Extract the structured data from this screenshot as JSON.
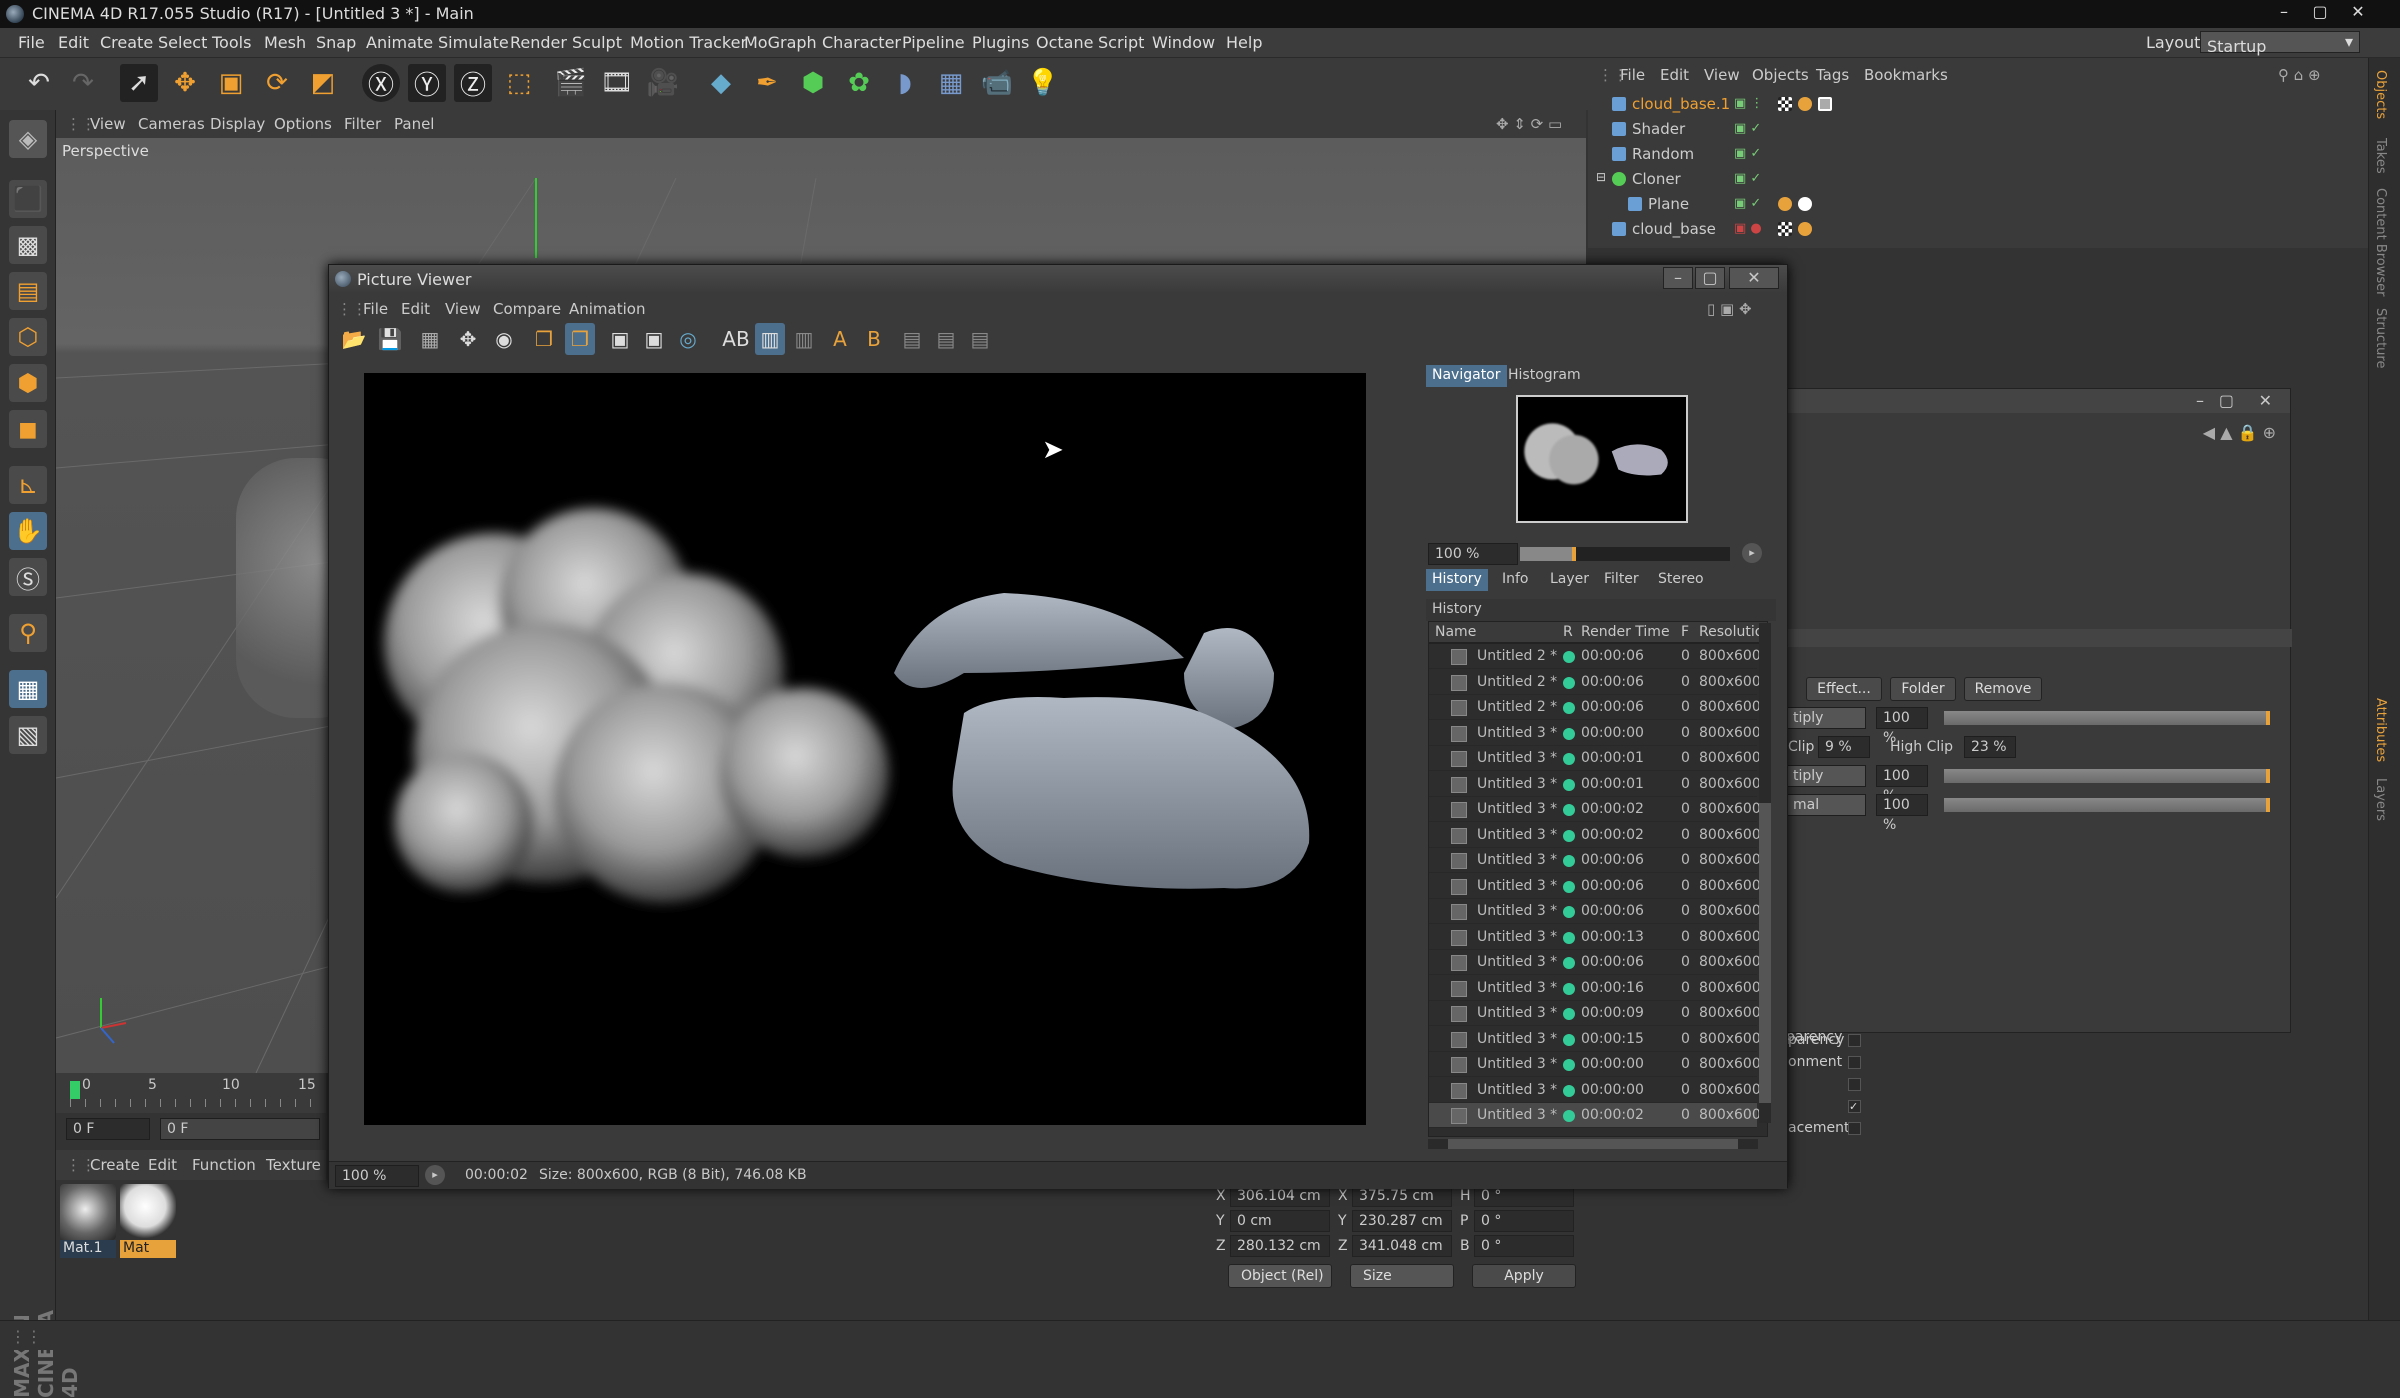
{
  "window": {
    "title": "CINEMA 4D R17.055 Studio (R17) - [Untitled 3 *] - Main"
  },
  "menubar": [
    "File",
    "Edit",
    "Create",
    "Select",
    "Tools",
    "Mesh",
    "Snap",
    "Animate",
    "Simulate",
    "Render",
    "Sculpt",
    "Motion Tracker",
    "MoGraph",
    "Character",
    "Pipeline",
    "Plugins",
    "Octane",
    "Script",
    "Window",
    "Help"
  ],
  "layout": {
    "label": "Layout:",
    "value": "Startup"
  },
  "viewport": {
    "menu": [
      "View",
      "Cameras",
      "Display",
      "Options",
      "Filter",
      "Panel"
    ],
    "label": "Perspective"
  },
  "timeline": {
    "ticks": [
      "0",
      "5",
      "10",
      "15"
    ],
    "frame": "0 F",
    "frame_field": "0 F"
  },
  "materials": {
    "menu": [
      "Create",
      "Edit",
      "Function",
      "Texture"
    ],
    "items": [
      {
        "label": "Mat.1"
      },
      {
        "label": "Mat"
      }
    ]
  },
  "coords": {
    "rows": [
      {
        "axis": "X",
        "pos": "306.104 cm",
        "size_axis": "X",
        "size": "375.75 cm",
        "rot_axis": "H",
        "rot": "0 °"
      },
      {
        "axis": "Y",
        "pos": "0 cm",
        "size_axis": "Y",
        "size": "230.287 cm",
        "rot_axis": "P",
        "rot": "0 °"
      },
      {
        "axis": "Z",
        "pos": "280.132 cm",
        "size_axis": "Z",
        "size": "341.048 cm",
        "rot_axis": "B",
        "rot": "0 °"
      }
    ],
    "mode": "Object (Rel)",
    "size_mode": "Size",
    "apply": "Apply"
  },
  "object_manager": {
    "menu": [
      "File",
      "Edit",
      "View",
      "Objects",
      "Tags",
      "Bookmarks"
    ],
    "objects": [
      {
        "name": "cloud_base.1",
        "highlight": true
      },
      {
        "name": "Shader"
      },
      {
        "name": "Random"
      },
      {
        "name": "Cloner"
      },
      {
        "name": "Plane"
      },
      {
        "name": "cloud_base"
      }
    ]
  },
  "right_tabs": [
    "Objects",
    "Takes",
    "Content Browser",
    "Structure",
    "Attributes",
    "Layers"
  ],
  "attributes": {
    "buttons": [
      "Effect...",
      "Folder",
      "Remove"
    ],
    "rows": [
      {
        "mode": "tiply",
        "pct": "100 %"
      },
      {
        "clip_label": "Clip",
        "clip": "9 %",
        "high_label": "High Clip",
        "high": "23 %"
      },
      {
        "mode": "tiply",
        "pct": "100 %"
      },
      {
        "mode": "mal",
        "pct": "100 %"
      }
    ],
    "checks": [
      "parency",
      "onment",
      "",
      "",
      "acement"
    ]
  },
  "picture_viewer": {
    "title": "Picture Viewer",
    "menu": [
      "File",
      "Edit",
      "View",
      "Compare",
      "Animation"
    ],
    "tabs_top": [
      "Navigator",
      "Histogram"
    ],
    "zoom": "100 %",
    "tabs_mid": [
      "History",
      "Info",
      "Layer",
      "Filter",
      "Stereo"
    ],
    "history_label": "History",
    "columns": [
      "Name",
      "R",
      "Render Time",
      "F",
      "Resolution"
    ],
    "history": [
      {
        "name": "Untitled 2 *",
        "time": "00:00:06",
        "f": "0",
        "res": "800x600"
      },
      {
        "name": "Untitled 2 *",
        "time": "00:00:06",
        "f": "0",
        "res": "800x600"
      },
      {
        "name": "Untitled 2 *",
        "time": "00:00:06",
        "f": "0",
        "res": "800x600"
      },
      {
        "name": "Untitled 3 *",
        "time": "00:00:00",
        "f": "0",
        "res": "800x600"
      },
      {
        "name": "Untitled 3 *",
        "time": "00:00:01",
        "f": "0",
        "res": "800x600"
      },
      {
        "name": "Untitled 3 *",
        "time": "00:00:01",
        "f": "0",
        "res": "800x600"
      },
      {
        "name": "Untitled 3 *",
        "time": "00:00:02",
        "f": "0",
        "res": "800x600"
      },
      {
        "name": "Untitled 3 *",
        "time": "00:00:02",
        "f": "0",
        "res": "800x600"
      },
      {
        "name": "Untitled 3 *",
        "time": "00:00:06",
        "f": "0",
        "res": "800x600"
      },
      {
        "name": "Untitled 3 *",
        "time": "00:00:06",
        "f": "0",
        "res": "800x600"
      },
      {
        "name": "Untitled 3 *",
        "time": "00:00:06",
        "f": "0",
        "res": "800x600"
      },
      {
        "name": "Untitled 3 *",
        "time": "00:00:13",
        "f": "0",
        "res": "800x600"
      },
      {
        "name": "Untitled 3 *",
        "time": "00:00:06",
        "f": "0",
        "res": "800x600"
      },
      {
        "name": "Untitled 3 *",
        "time": "00:00:16",
        "f": "0",
        "res": "800x600"
      },
      {
        "name": "Untitled 3 *",
        "time": "00:00:09",
        "f": "0",
        "res": "800x600"
      },
      {
        "name": "Untitled 3 *",
        "time": "00:00:15",
        "f": "0",
        "res": "800x600"
      },
      {
        "name": "Untitled 3 *",
        "time": "00:00:00",
        "f": "0",
        "res": "800x600"
      },
      {
        "name": "Untitled 3 *",
        "time": "00:00:00",
        "f": "0",
        "res": "800x600"
      },
      {
        "name": "Untitled 3 *",
        "time": "00:00:02",
        "f": "0",
        "res": "800x600",
        "selected": true
      }
    ],
    "status_zoom": "100 %",
    "status_time": "00:00:02",
    "status_info": "Size: 800x600, RGB (8 Bit), 746.08 KB"
  },
  "colors": {
    "accent": "#e8a23c",
    "selection": "#4d6f8e",
    "render_ok": "#33cc99"
  }
}
